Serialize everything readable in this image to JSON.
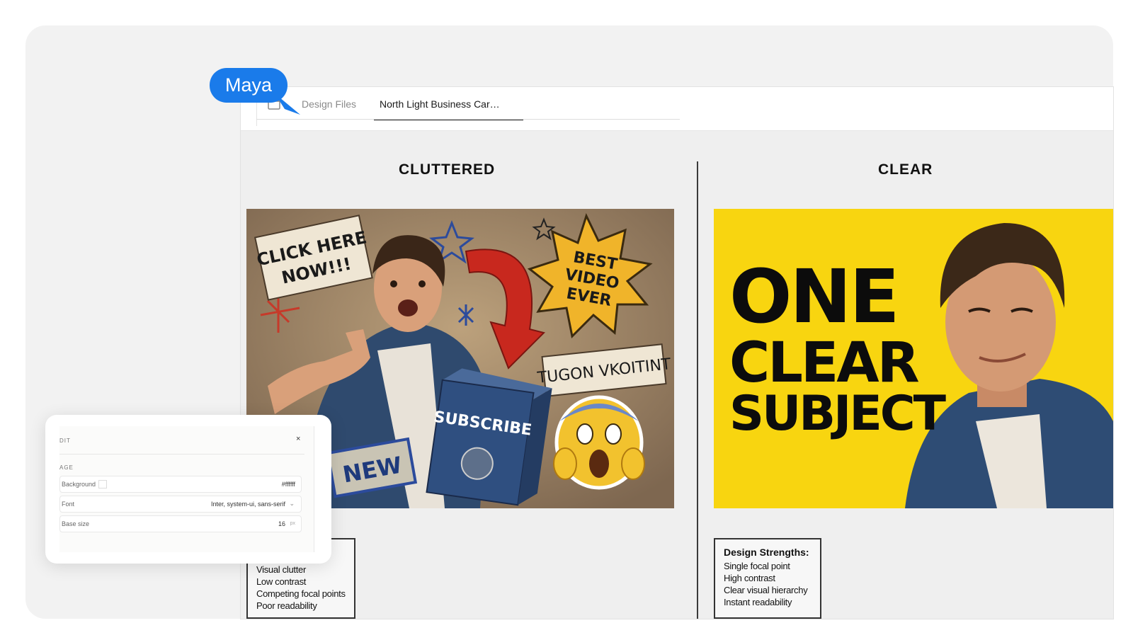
{
  "tabs": {
    "design_files": "Design Files",
    "active": "North Light Business Car…"
  },
  "cursor": {
    "user_label": "Maya",
    "color": "#1a7bea"
  },
  "columns": {
    "left_title": "CLUTTERED",
    "right_title": "CLEAR"
  },
  "left_thumbnail": {
    "texts": [
      "CLICK HERE NOW!!!",
      "BEST VIDEO EVER",
      "SUBSCRIBE",
      "NEW",
      "TUGON VKOITINT"
    ]
  },
  "right_thumbnail": {
    "line1": "ONE",
    "line2": "CLEAR",
    "line3": "SUBJECT",
    "background": "#f8d510"
  },
  "left_notes": {
    "items": [
      "Visual clutter",
      "Low contrast",
      "Competing focal points",
      "Poor readability"
    ]
  },
  "right_notes": {
    "heading": "Design Strengths:",
    "items": [
      "Single focal point",
      "High contrast",
      "Clear visual hierarchy",
      "Instant readability"
    ]
  },
  "edit_panel": {
    "title": "DIT",
    "close": "×",
    "section": "AGE",
    "rows": [
      {
        "label": "Background",
        "value": "#ffffff"
      },
      {
        "label": "Font",
        "value": "Inter, system-ui, sans-serif"
      },
      {
        "label": "Base size",
        "value": "16",
        "unit": "px"
      }
    ]
  }
}
